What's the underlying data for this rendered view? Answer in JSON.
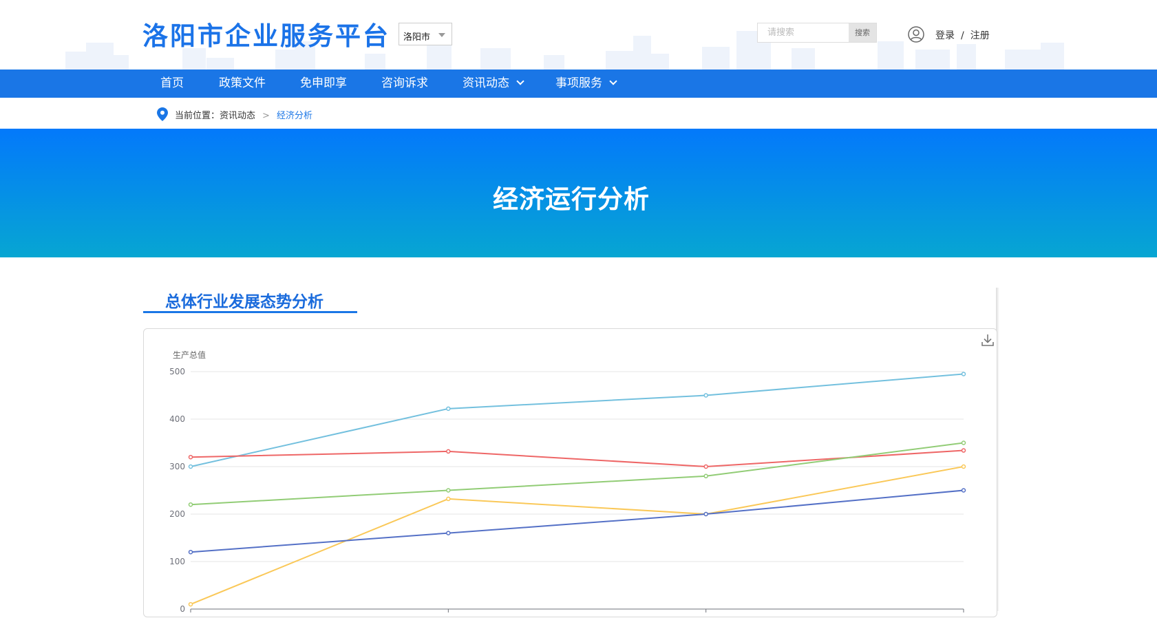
{
  "header": {
    "logo_text": "洛阳市企业服务平台",
    "city_select_value": "洛阳市",
    "search_placeholder": "请搜索",
    "search_button": "搜索",
    "login": "登录",
    "separator": "/",
    "register": "注册"
  },
  "nav": {
    "items": [
      {
        "label": "首页",
        "has_dropdown": false
      },
      {
        "label": "政策文件",
        "has_dropdown": false
      },
      {
        "label": "免申即享",
        "has_dropdown": false
      },
      {
        "label": "咨询诉求",
        "has_dropdown": false
      },
      {
        "label": "资讯动态",
        "has_dropdown": true
      },
      {
        "label": "事项服务",
        "has_dropdown": true
      }
    ]
  },
  "breadcrumb": {
    "prefix": "当前位置：",
    "parent": "资讯动态",
    "separator": ">",
    "current": "经济分析"
  },
  "banner": {
    "title": "经济运行分析"
  },
  "section": {
    "title": "总体行业发展态势分析"
  },
  "icons": {
    "logo_skyline": "city-skyline",
    "user": "user-circle-icon",
    "breadcrumb": "location-pin-icon",
    "chart_tool": "download-icon"
  },
  "colors": {
    "primary": "#1a76e6",
    "banner_top": "#0379fb",
    "banner_bottom": "#07a6d2"
  },
  "chart_data": {
    "type": "line",
    "ylabel": "生产总值",
    "ylim": [
      0,
      500
    ],
    "yticks": [
      0,
      100,
      200,
      300,
      400,
      500
    ],
    "x_count": 4,
    "grid": true,
    "series": [
      {
        "color": "#73c0de",
        "values": [
          300,
          422,
          450,
          495
        ]
      },
      {
        "color": "#ee6666",
        "values": [
          320,
          332,
          300,
          334
        ]
      },
      {
        "color": "#91cc75",
        "values": [
          220,
          250,
          280,
          350
        ]
      },
      {
        "color": "#fac858",
        "values": [
          10,
          232,
          200,
          300
        ]
      },
      {
        "color": "#5470c6",
        "values": [
          120,
          160,
          200,
          250
        ]
      }
    ]
  }
}
